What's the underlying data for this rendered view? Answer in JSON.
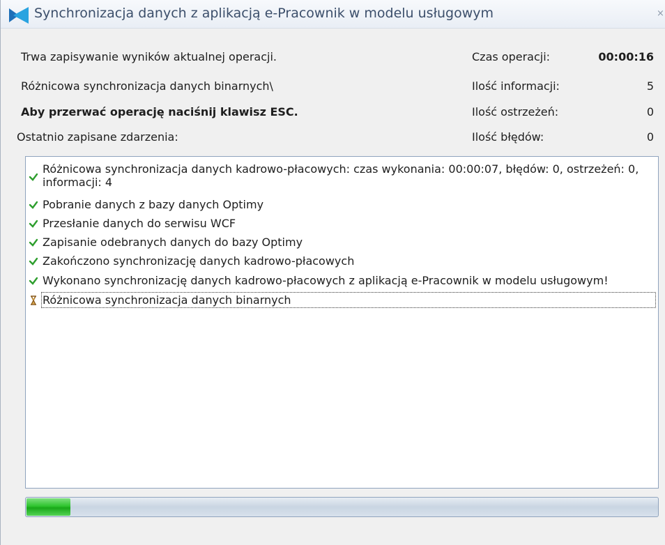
{
  "window": {
    "title": "Synchronizacja danych z aplikacją e-Pracownik w modelu usługowym",
    "close_glyph": "×"
  },
  "status": {
    "line1": "Trwa zapisywanie wyników aktualnej operacji.",
    "line2": "Różnicowa synchronizacja danych binarnych\\",
    "line3": "Aby przerwać operację naciśnij klawisz ESC.",
    "line4": "Ostatnio zapisane zdarzenia:"
  },
  "stats": {
    "time_label": "Czas operacji:",
    "time_value": "00:00:16",
    "info_label": "Ilość informacji:",
    "info_value": "5",
    "warn_label": "Ilość ostrzeżeń:",
    "warn_value": "0",
    "err_label": "Ilość błędów:",
    "err_value": "0"
  },
  "log": [
    {
      "icon": "check-icon",
      "text": "Różnicowa synchronizacja danych kadrowo-płacowych: czas wykonania: 00:00:07, błędów: 0, ostrzeżeń: 0, informacji: 4"
    },
    {
      "icon": "check-icon",
      "text": "Pobranie danych z bazy danych Optimy"
    },
    {
      "icon": "check-icon",
      "text": "Przesłanie danych do serwisu WCF"
    },
    {
      "icon": "check-icon",
      "text": "Zapisanie odebranych danych do bazy Optimy"
    },
    {
      "icon": "check-icon",
      "text": "Zakończono synchronizację danych kadrowo-płacowych"
    },
    {
      "icon": "check-icon",
      "text": "Wykonano synchronizację danych kadrowo-płacowych z aplikacją e-Pracownik w modelu usługowym!"
    },
    {
      "icon": "hourglass-icon",
      "text": "Różnicowa synchronizacja danych binarnych"
    }
  ],
  "progress": {
    "fraction": 0.07
  },
  "colors": {
    "check": "#2e9e2e",
    "hourglass": "#b07a2a",
    "progress_fill": "#2ec42e"
  }
}
